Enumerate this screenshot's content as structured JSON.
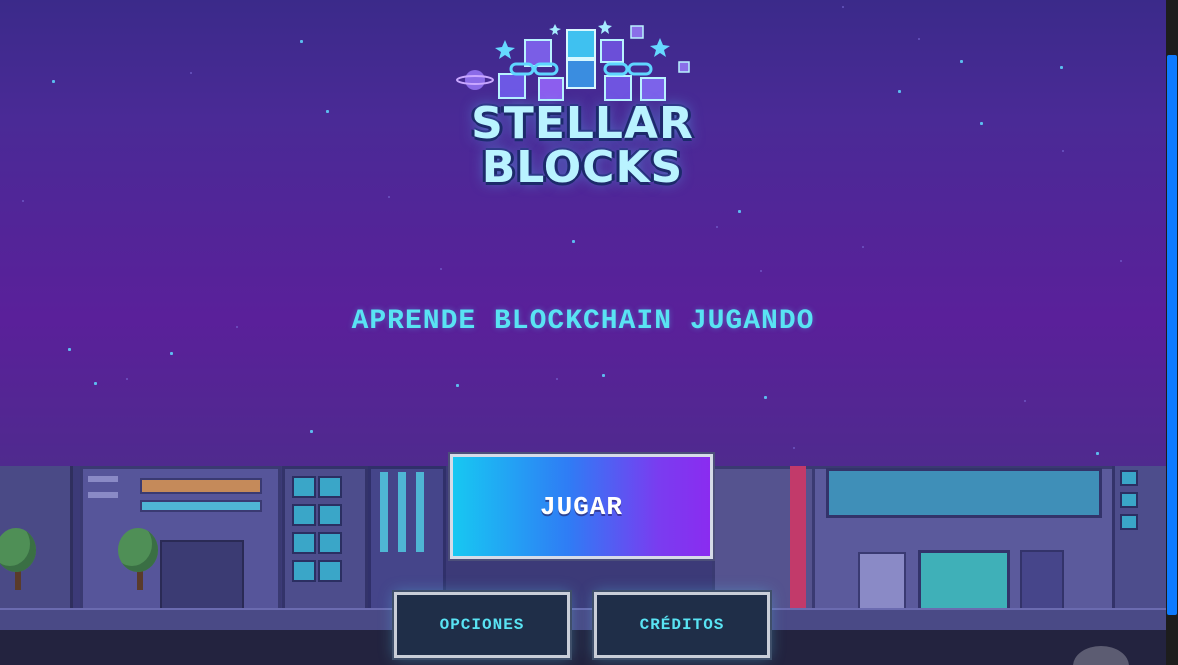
{
  "logo": {
    "line1": "STELLAR",
    "line2": "BLOCKS",
    "icon": "blockchain-cubes-icon"
  },
  "tagline": "APRENDE BLOCKCHAIN JUGANDO",
  "menu": {
    "play_label": "JUGAR",
    "options_label": "OPCIONES",
    "credits_label": "CRÉDITOS"
  },
  "colors": {
    "tagline": "#59e3f3",
    "play_gradient_start": "#17c8f2",
    "play_gradient_end": "#8a2cf0",
    "small_button_bg": "#1f2e48",
    "scrollbar_thumb": "#0e7bff"
  }
}
